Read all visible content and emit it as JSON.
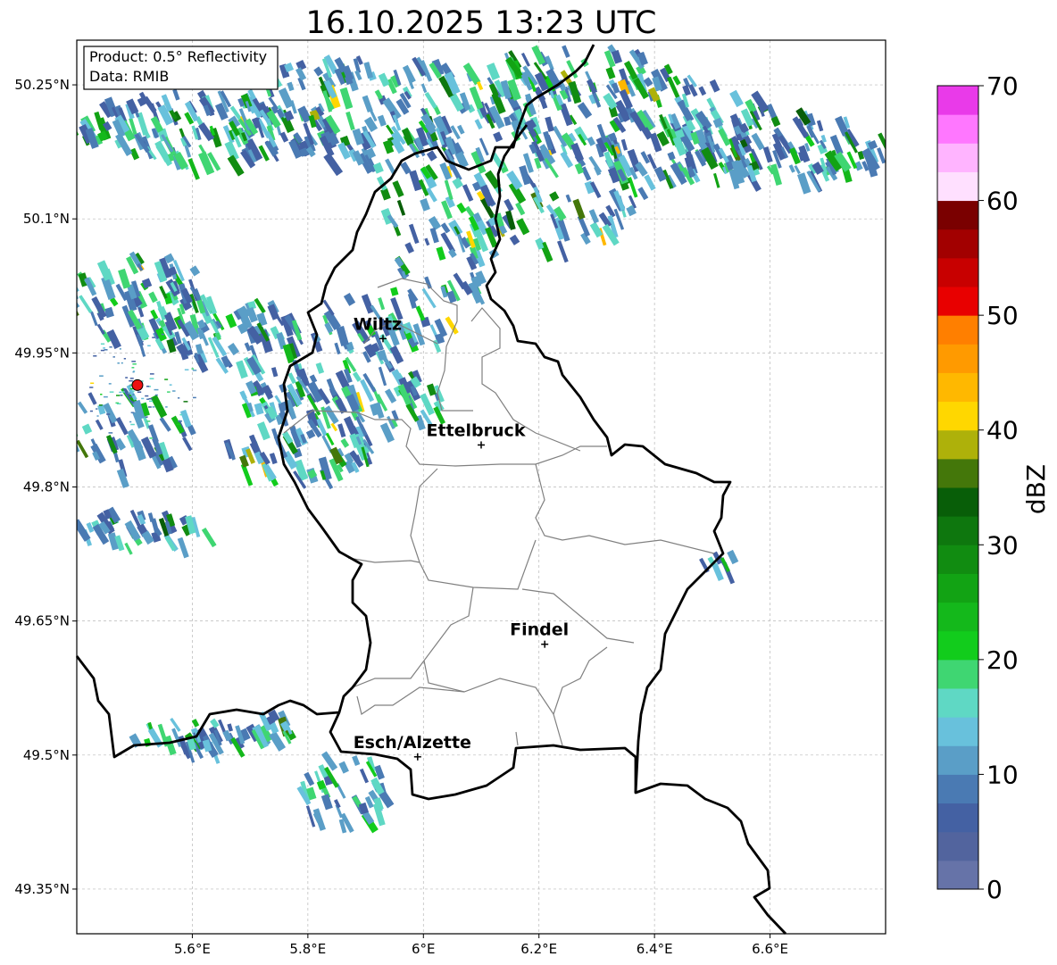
{
  "map": {
    "title": "16.10.2025 13:23 UTC",
    "info_box": {
      "product": "Product: 0.5° Reflectivity",
      "data_source": "Data: RMIB"
    },
    "lon_ticks": [
      "5.6°E",
      "5.8°E",
      "6°E",
      "6.2°E",
      "6.4°E",
      "6.6°E"
    ],
    "lat_ticks": [
      "50.25°N",
      "50.1°N",
      "49.95°N",
      "49.8°N",
      "49.65°N",
      "49.5°N",
      "49.35°N"
    ],
    "cities": [
      {
        "name": "Wiltz",
        "lon": 5.93,
        "lat": 49.966
      },
      {
        "name": "Ettelbruck",
        "lon": 6.1,
        "lat": 49.847
      },
      {
        "name": "Findel",
        "lon": 6.21,
        "lat": 49.624
      },
      {
        "name": "Esch/Alzette",
        "lon": 5.99,
        "lat": 49.498
      }
    ],
    "radar_site": {
      "lon": 5.505,
      "lat": 49.914,
      "color": "#ee1111"
    },
    "extent": {
      "lon": [
        5.4,
        6.8
      ],
      "lat": [
        49.3,
        50.3
      ]
    }
  },
  "colorbar": {
    "label": "dBZ",
    "range": [
      0,
      70
    ],
    "tick_labels": [
      "0",
      "10",
      "20",
      "30",
      "40",
      "50",
      "60",
      "70"
    ],
    "colors": [
      "#6673a8",
      "#52649e",
      "#4461a3",
      "#4a7ab3",
      "#5a9ec7",
      "#68c1dc",
      "#5fd8c4",
      "#3fd672",
      "#12cc1c",
      "#14b81b",
      "#12a314",
      "#118c11",
      "#0e770e",
      "#085e08",
      "#44770a",
      "#aeb10a",
      "#ffd700",
      "#ffb800",
      "#ff9a00",
      "#ff7f00",
      "#e80000",
      "#c80000",
      "#a20000",
      "#7a0000",
      "#ffe0ff",
      "#ffb4ff",
      "#ff77ff",
      "#e93ae9"
    ]
  }
}
